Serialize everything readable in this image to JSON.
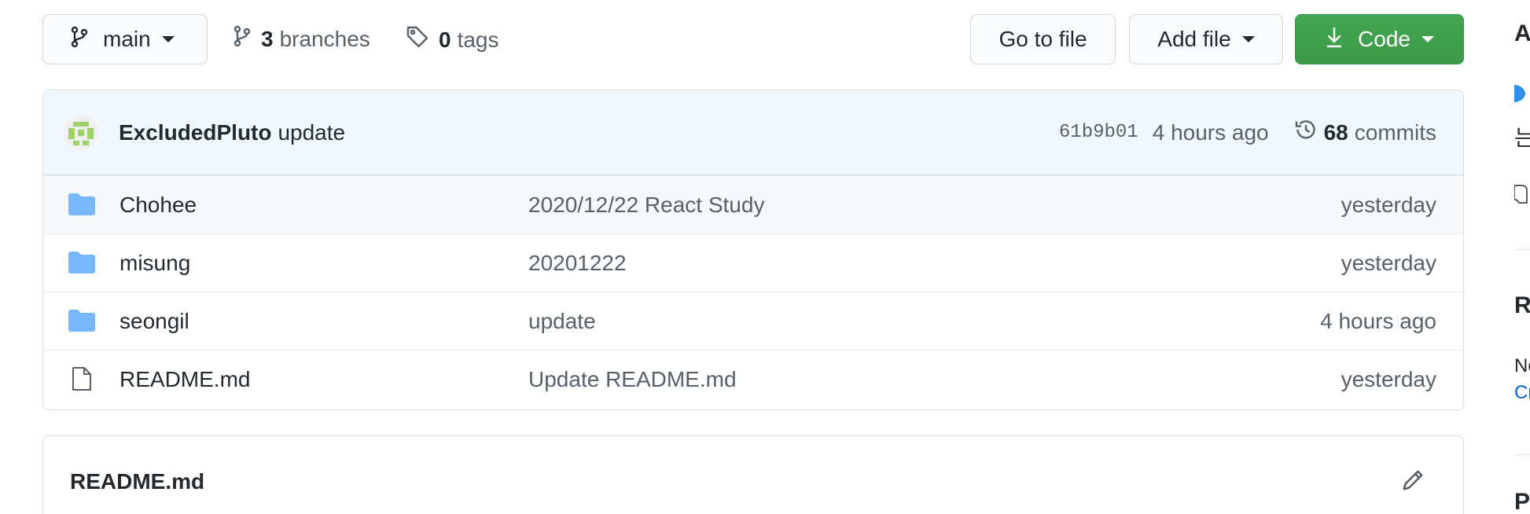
{
  "toolbar": {
    "branch_label": "main",
    "branches_count": "3",
    "branches_label": "branches",
    "tags_count": "0",
    "tags_label": "tags",
    "goto_file_label": "Go to file",
    "add_file_label": "Add file",
    "code_label": "Code"
  },
  "latest_commit": {
    "author": "ExcludedPluto",
    "message": "update",
    "sha": "61b9b01",
    "time": "4 hours ago",
    "commits_count": "68",
    "commits_label": "commits"
  },
  "files": [
    {
      "name": "Chohee",
      "type": "folder",
      "commit": "2020/12/22 React Study",
      "age": "yesterday"
    },
    {
      "name": "misung",
      "type": "folder",
      "commit": "20201222",
      "age": "yesterday"
    },
    {
      "name": "seongil",
      "type": "folder",
      "commit": "update",
      "age": "4 hours ago"
    },
    {
      "name": "README.md",
      "type": "file",
      "commit": "Update README.md",
      "age": "yesterday"
    }
  ],
  "readme": {
    "title": "README.md"
  },
  "sidebar": {
    "about_initial": "A",
    "line2_initial": "는",
    "releases_initial": "R",
    "releases_small": "No",
    "releases_link": "Cr",
    "packages_initial": "P"
  },
  "colors": {
    "accent_green": "#3c9a48",
    "folder_blue": "#79b8ff",
    "link_blue": "#0366d6",
    "commit_header_bg": "#f1f8ff"
  }
}
